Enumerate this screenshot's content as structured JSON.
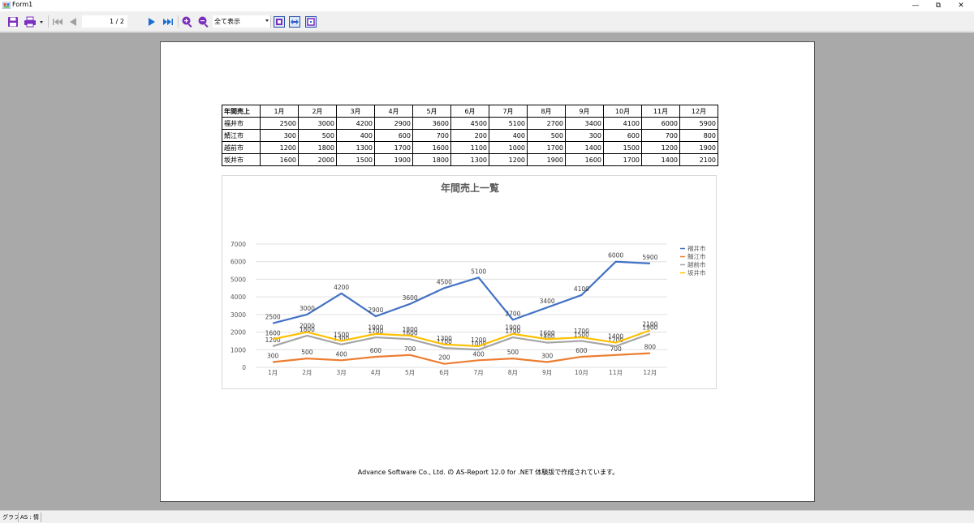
{
  "window": {
    "title": "Form1",
    "minimize_glyph": "—",
    "maximize_glyph": "⧉",
    "close_glyph": "✕"
  },
  "toolbar": {
    "icons": [
      "save-icon",
      "print-icon",
      "first-page-icon",
      "prev-page-icon",
      "next-page-icon",
      "last-page-icon",
      "zoom-in-icon",
      "zoom-out-icon",
      "fit-page-icon",
      "fit-width-icon",
      "actual-size-icon"
    ],
    "page_indicator": "1 / 2",
    "zoom_value": "全て表示"
  },
  "report": {
    "table": {
      "header": [
        "年間売上",
        "1月",
        "2月",
        "3月",
        "4月",
        "5月",
        "6月",
        "7月",
        "8月",
        "9月",
        "10月",
        "11月",
        "12月"
      ],
      "rows": [
        [
          "福井市",
          "2500",
          "3000",
          "4200",
          "2900",
          "3600",
          "4500",
          "5100",
          "2700",
          "3400",
          "4100",
          "6000",
          "5900"
        ],
        [
          "鯖江市",
          "300",
          "500",
          "400",
          "600",
          "700",
          "200",
          "400",
          "500",
          "300",
          "600",
          "700",
          "800"
        ],
        [
          "越前市",
          "1200",
          "1800",
          "1300",
          "1700",
          "1600",
          "1100",
          "1000",
          "1700",
          "1400",
          "1500",
          "1200",
          "1900"
        ],
        [
          "坂井市",
          "1600",
          "2000",
          "1500",
          "1900",
          "1800",
          "1300",
          "1200",
          "1900",
          "1600",
          "1700",
          "1400",
          "2100"
        ]
      ]
    },
    "footer": "Advance Software Co., Ltd. の AS-Report 12.0 for .NET 体験版で作成されています。"
  },
  "chart_data": {
    "type": "line",
    "title": "年間売上一覧",
    "categories": [
      "1月",
      "2月",
      "3月",
      "4月",
      "5月",
      "6月",
      "7月",
      "8月",
      "9月",
      "10月",
      "11月",
      "12月"
    ],
    "series": [
      {
        "name": "福井市",
        "color": "#4472c4",
        "values": [
          2500,
          3000,
          4200,
          2900,
          3600,
          4500,
          5100,
          2700,
          3400,
          4100,
          6000,
          5900
        ]
      },
      {
        "name": "鯖江市",
        "color": "#ed7d31",
        "values": [
          300,
          500,
          400,
          600,
          700,
          200,
          400,
          500,
          300,
          600,
          700,
          800
        ]
      },
      {
        "name": "越前市",
        "color": "#a5a5a5",
        "values": [
          1200,
          1800,
          1300,
          1700,
          1600,
          1100,
          1000,
          1700,
          1400,
          1500,
          1200,
          1900
        ]
      },
      {
        "name": "坂井市",
        "color": "#ffc000",
        "values": [
          1600,
          2000,
          1500,
          1900,
          1800,
          1300,
          1200,
          1900,
          1600,
          1700,
          1400,
          2100
        ]
      }
    ],
    "yticks": [
      "0",
      "1000",
      "2000",
      "3000",
      "4000",
      "5000",
      "6000",
      "7000"
    ],
    "ylim": [
      0,
      7000
    ],
    "grid": true,
    "legend": "right"
  },
  "statusbar": {
    "items": [
      "グラフ",
      "AS : 情"
    ]
  }
}
